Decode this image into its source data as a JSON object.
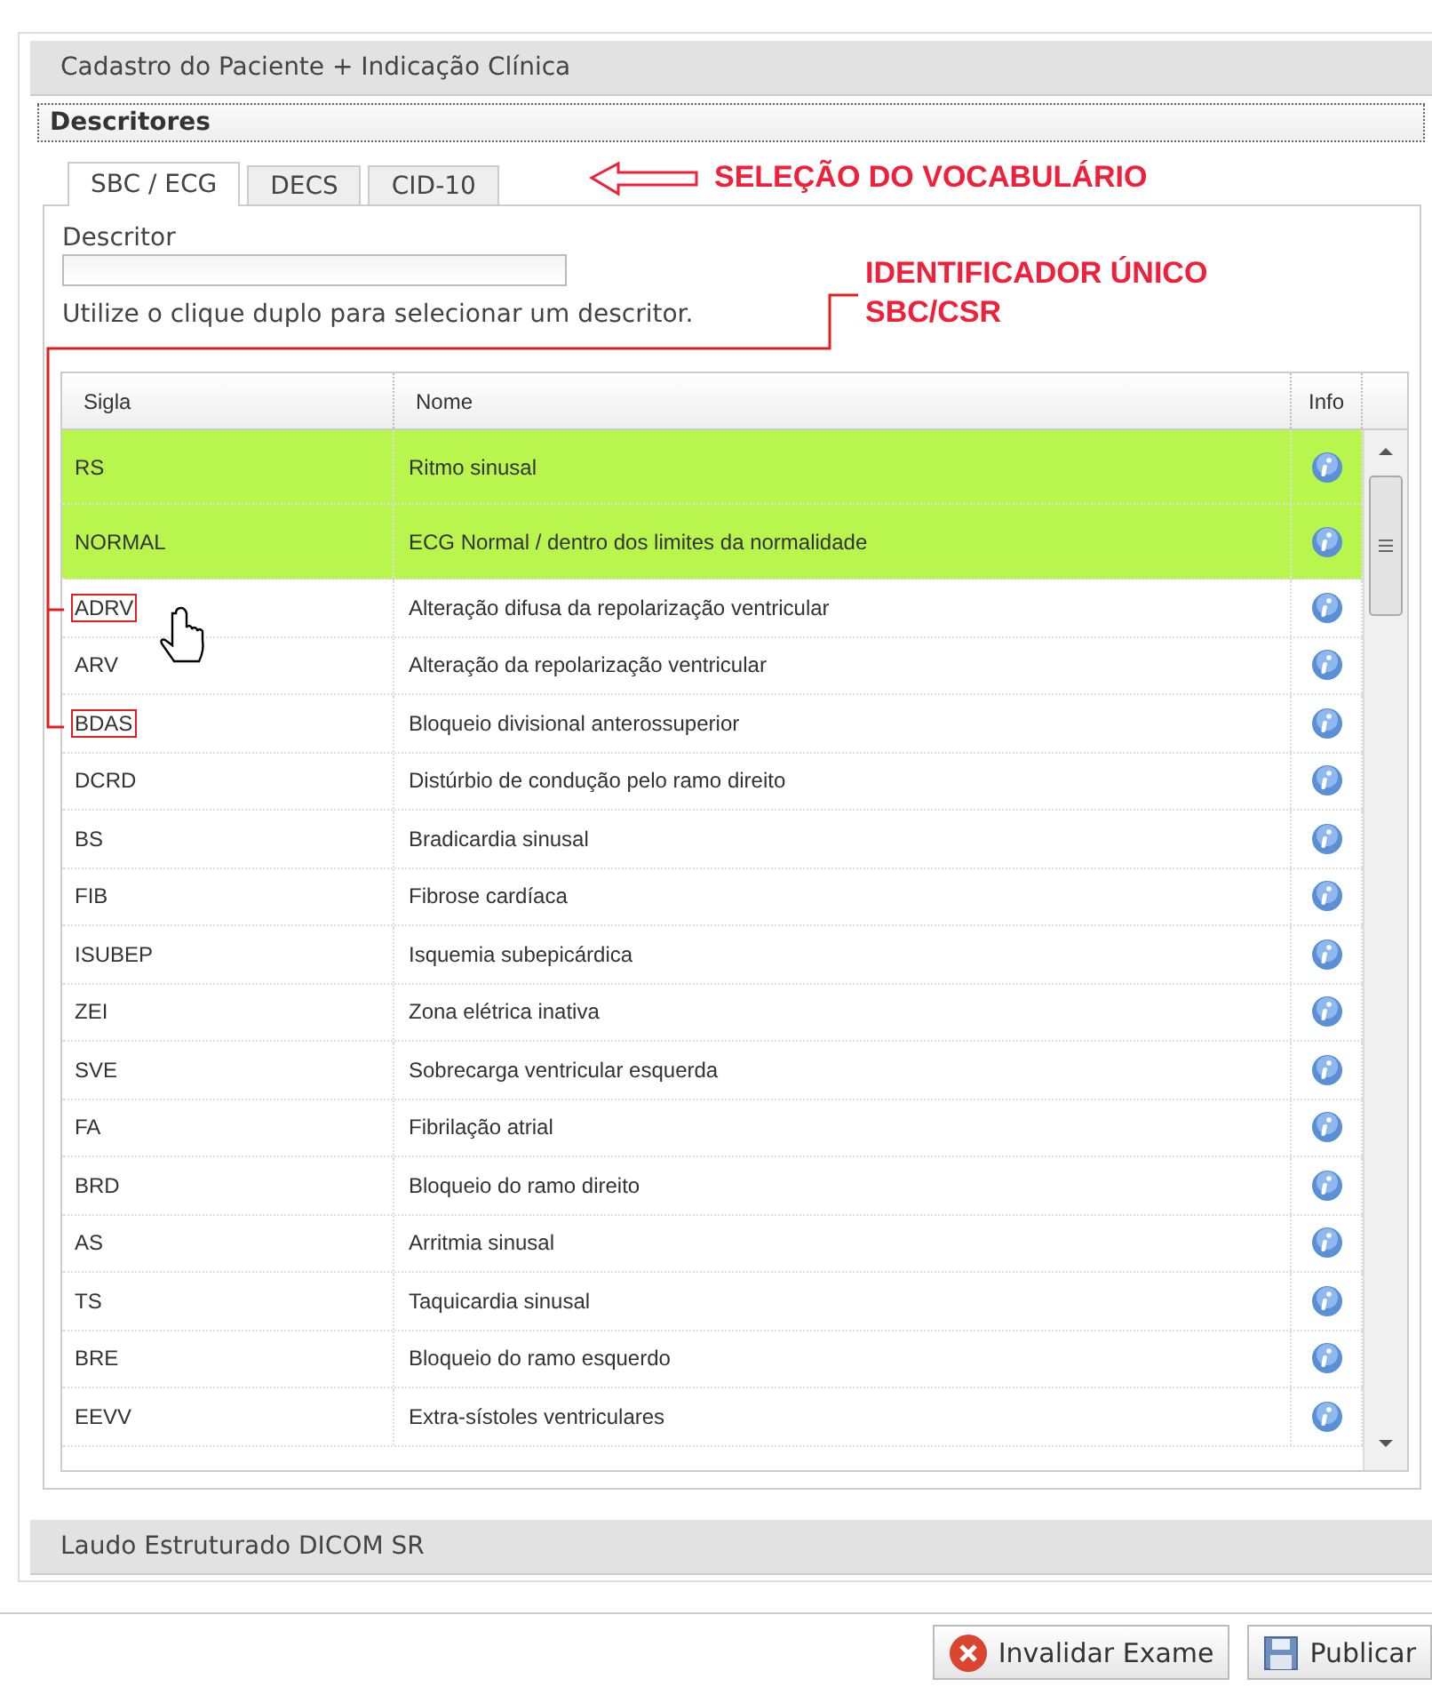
{
  "panel_title": "Cadastro do Paciente + Indicação Clínica",
  "section_title": "Descritores",
  "tabs": [
    {
      "label": "SBC / ECG",
      "selected": true
    },
    {
      "label": "DECS",
      "selected": false
    },
    {
      "label": "CID-10",
      "selected": false
    }
  ],
  "vocabulary_note": "SELEÇÃO DO VOCABULÁRIO",
  "descriptor_field": {
    "label": "Descritor",
    "hint": "Utilize o clique duplo para selecionar um descritor."
  },
  "identifier_note": [
    "IDENTIFICADOR ÚNICO",
    "SBC/CSR"
  ],
  "table": {
    "columns": [
      "Sigla",
      "Nome",
      "Info"
    ],
    "rows": [
      {
        "sigla": "RS",
        "nome": "Ritmo sinusal",
        "selected": true,
        "boxed": false
      },
      {
        "sigla": "NORMAL",
        "nome": "ECG Normal / dentro dos limites da normalidade",
        "selected": true,
        "boxed": false
      },
      {
        "sigla": "ADRV",
        "nome": "Alteração difusa da repolarização ventricular",
        "selected": false,
        "boxed": true
      },
      {
        "sigla": "ARV",
        "nome": "Alteração da repolarização ventricular",
        "selected": false,
        "boxed": false
      },
      {
        "sigla": "BDAS",
        "nome": "Bloqueio divisional anterossuperior",
        "selected": false,
        "boxed": true
      },
      {
        "sigla": "DCRD",
        "nome": "Distúrbio de condução pelo ramo direito",
        "selected": false,
        "boxed": false
      },
      {
        "sigla": "BS",
        "nome": "Bradicardia sinusal",
        "selected": false,
        "boxed": false
      },
      {
        "sigla": "FIB",
        "nome": "Fibrose cardíaca",
        "selected": false,
        "boxed": false
      },
      {
        "sigla": "ISUBEP",
        "nome": "Isquemia subepicárdica",
        "selected": false,
        "boxed": false
      },
      {
        "sigla": "ZEI",
        "nome": "Zona elétrica inativa",
        "selected": false,
        "boxed": false
      },
      {
        "sigla": "SVE",
        "nome": "Sobrecarga ventricular esquerda",
        "selected": false,
        "boxed": false
      },
      {
        "sigla": "FA",
        "nome": "Fibrilação atrial",
        "selected": false,
        "boxed": false
      },
      {
        "sigla": "BRD",
        "nome": "Bloqueio do ramo direito",
        "selected": false,
        "boxed": false
      },
      {
        "sigla": "AS",
        "nome": "Arritmia sinusal",
        "selected": false,
        "boxed": false
      },
      {
        "sigla": "TS",
        "nome": "Taquicardia sinusal",
        "selected": false,
        "boxed": false
      },
      {
        "sigla": "BRE",
        "nome": "Bloqueio do ramo esquerdo",
        "selected": false,
        "boxed": false
      },
      {
        "sigla": "EEVV",
        "nome": "Extra-sístoles ventriculares",
        "selected": false,
        "boxed": false
      }
    ]
  },
  "collapsed_section": "Laudo Estruturado DICOM SR",
  "buttons": [
    "Invalidar Exame",
    "Publicar"
  ]
}
